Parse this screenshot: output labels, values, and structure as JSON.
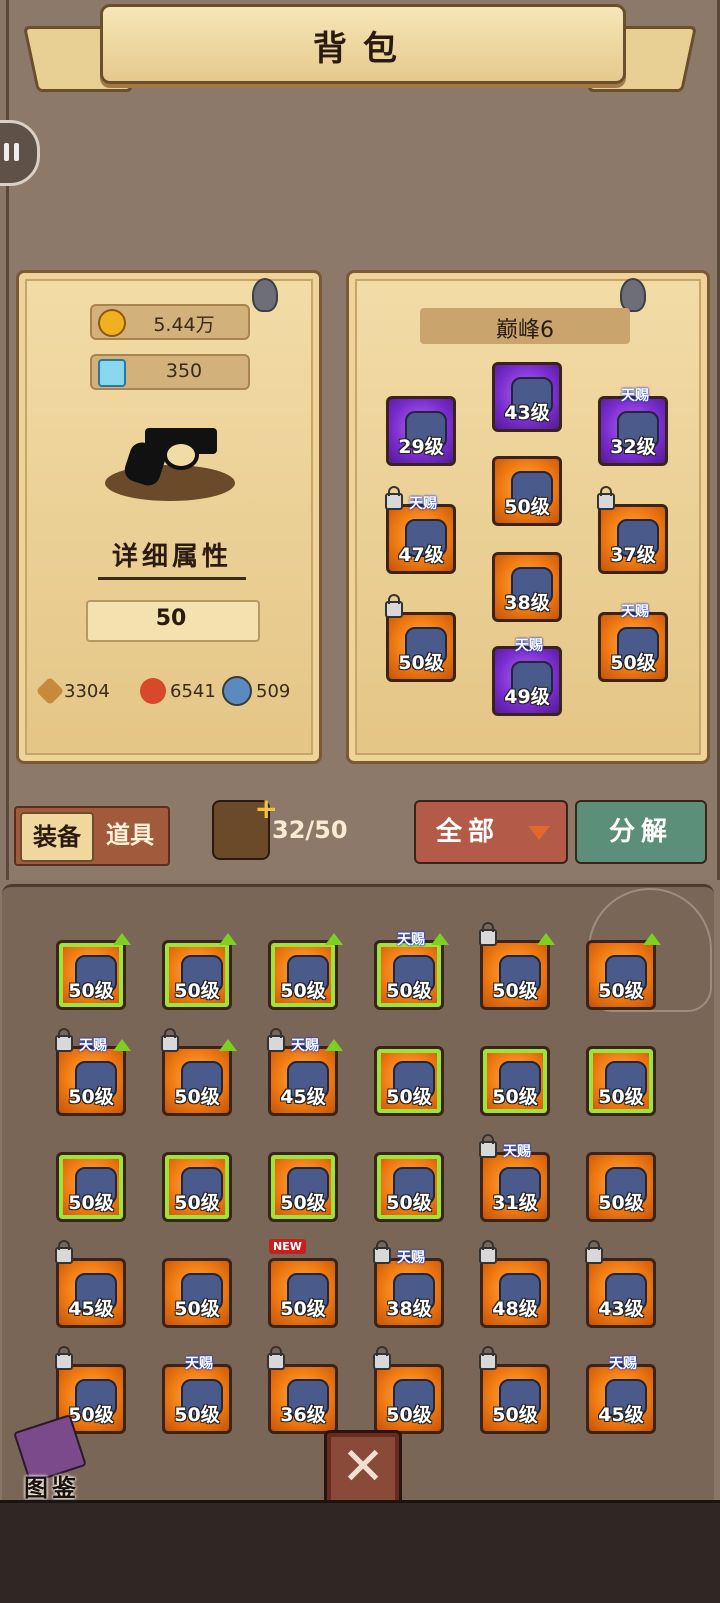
{
  "title": "背包",
  "icons": {
    "pause": "pause-icon",
    "coin": "coin-icon",
    "diamond": "diamond-icon",
    "close": "close-icon",
    "book": "book-icon"
  },
  "currency": {
    "gold": "5.44万",
    "diamond": "350"
  },
  "hero": {
    "weapon": "revolver",
    "detail_label": "详细属性",
    "level": "50"
  },
  "stats": {
    "attack": "3304",
    "hp": "6541",
    "defense": "509"
  },
  "peak": {
    "label": "巅峰6"
  },
  "equipped": [
    {
      "lv": "29级",
      "color": "purple",
      "tag": "",
      "lock": false
    },
    {
      "lv": "43级",
      "color": "purple",
      "tag": "",
      "lock": false
    },
    {
      "lv": "32级",
      "color": "purple",
      "tag": "天赐",
      "lock": false
    },
    {
      "lv": "50级",
      "color": "orange",
      "tag": "",
      "lock": false
    },
    {
      "lv": "47级",
      "color": "orange",
      "tag": "天赐",
      "lock": true
    },
    {
      "lv": "37级",
      "color": "orange",
      "tag": "",
      "lock": true
    },
    {
      "lv": "38级",
      "color": "orange",
      "tag": "",
      "lock": false
    },
    {
      "lv": "50级",
      "color": "orange",
      "tag": "",
      "lock": true
    },
    {
      "lv": "50级",
      "color": "orange",
      "tag": "天赐",
      "lock": false
    },
    {
      "lv": "49级",
      "color": "purple",
      "tag": "天赐",
      "lock": false
    }
  ],
  "tabs": {
    "equip": "装备",
    "items": "道具"
  },
  "capacity": "32/50",
  "filter": {
    "label": "全部"
  },
  "decompose": "分解",
  "inventory": [
    {
      "lv": "50级",
      "tag": "",
      "lock": false,
      "up": true,
      "green": true
    },
    {
      "lv": "50级",
      "tag": "",
      "lock": false,
      "up": true,
      "green": true
    },
    {
      "lv": "50级",
      "tag": "",
      "lock": false,
      "up": true,
      "green": true
    },
    {
      "lv": "50级",
      "tag": "天赐",
      "lock": false,
      "up": true,
      "green": true
    },
    {
      "lv": "50级",
      "tag": "",
      "lock": true,
      "up": true,
      "green": false
    },
    {
      "lv": "50级",
      "tag": "",
      "lock": false,
      "up": true,
      "green": false
    },
    {
      "lv": "50级",
      "tag": "天赐",
      "lock": true,
      "up": true,
      "green": false
    },
    {
      "lv": "50级",
      "tag": "",
      "lock": true,
      "up": true,
      "green": false
    },
    {
      "lv": "45级",
      "tag": "天赐",
      "lock": true,
      "up": true,
      "green": false
    },
    {
      "lv": "50级",
      "tag": "",
      "lock": false,
      "up": false,
      "green": true
    },
    {
      "lv": "50级",
      "tag": "",
      "lock": false,
      "up": false,
      "green": true
    },
    {
      "lv": "50级",
      "tag": "",
      "lock": false,
      "up": false,
      "green": true
    },
    {
      "lv": "50级",
      "tag": "",
      "lock": false,
      "up": false,
      "green": true
    },
    {
      "lv": "50级",
      "tag": "",
      "lock": false,
      "up": false,
      "green": true
    },
    {
      "lv": "50级",
      "tag": "",
      "lock": false,
      "up": false,
      "green": true
    },
    {
      "lv": "50级",
      "tag": "",
      "lock": false,
      "up": false,
      "green": true
    },
    {
      "lv": "31级",
      "tag": "天赐",
      "lock": true,
      "up": false,
      "green": false
    },
    {
      "lv": "50级",
      "tag": "",
      "lock": false,
      "up": false,
      "green": false
    },
    {
      "lv": "45级",
      "tag": "",
      "lock": true,
      "up": false,
      "green": false
    },
    {
      "lv": "50级",
      "tag": "",
      "lock": false,
      "up": false,
      "green": false
    },
    {
      "lv": "50级",
      "tag": "",
      "lock": false,
      "up": false,
      "green": false,
      "new": "NEW"
    },
    {
      "lv": "38级",
      "tag": "天赐",
      "lock": true,
      "up": false,
      "green": false
    },
    {
      "lv": "48级",
      "tag": "",
      "lock": true,
      "up": false,
      "green": false
    },
    {
      "lv": "43级",
      "tag": "",
      "lock": true,
      "up": false,
      "green": false
    },
    {
      "lv": "50级",
      "tag": "",
      "lock": true,
      "up": false,
      "green": false
    },
    {
      "lv": "50级",
      "tag": "天赐",
      "lock": false,
      "up": false,
      "green": false
    },
    {
      "lv": "36级",
      "tag": "",
      "lock": true,
      "up": false,
      "green": false
    },
    {
      "lv": "50级",
      "tag": "",
      "lock": true,
      "up": false,
      "green": false
    },
    {
      "lv": "50级",
      "tag": "",
      "lock": true,
      "up": false,
      "green": false
    },
    {
      "lv": "45级",
      "tag": "天赐",
      "lock": false,
      "up": false,
      "green": false
    }
  ],
  "codex": "图鉴"
}
